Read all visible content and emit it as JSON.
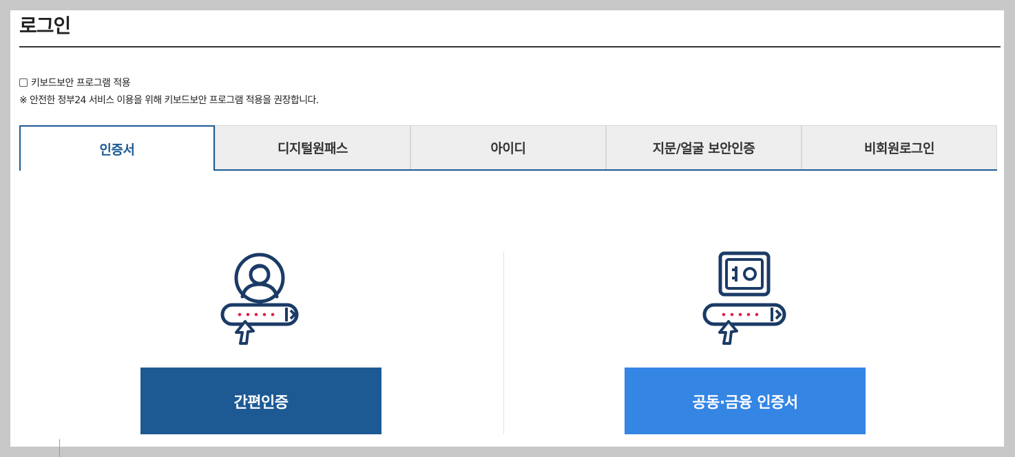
{
  "page": {
    "title": "로그인"
  },
  "keyboard_security": {
    "checkbox_label": "키보드보안 프로그램 적용",
    "notice": "※ 안전한 정부24 서비스 이용을 위해 키보드보안 프로그램 적용을 권장합니다.",
    "checked": false
  },
  "tabs": [
    {
      "label": "인증서",
      "active": true
    },
    {
      "label": "디지털원패스",
      "active": false
    },
    {
      "label": "아이디",
      "active": false
    },
    {
      "label": "지문/얼굴 보안인증",
      "active": false
    },
    {
      "label": "비회원로그인",
      "active": false
    }
  ],
  "options": {
    "simple_auth": {
      "label": "간편인증",
      "icon": "user-password-icon"
    },
    "joint_cert": {
      "label": "공동·금융 인증서",
      "icon": "safe-password-icon"
    }
  },
  "colors": {
    "primary": "#1d5a94",
    "accent": "#3585e5",
    "icon_dark": "#1b3b66",
    "icon_red": "#e0204a"
  }
}
